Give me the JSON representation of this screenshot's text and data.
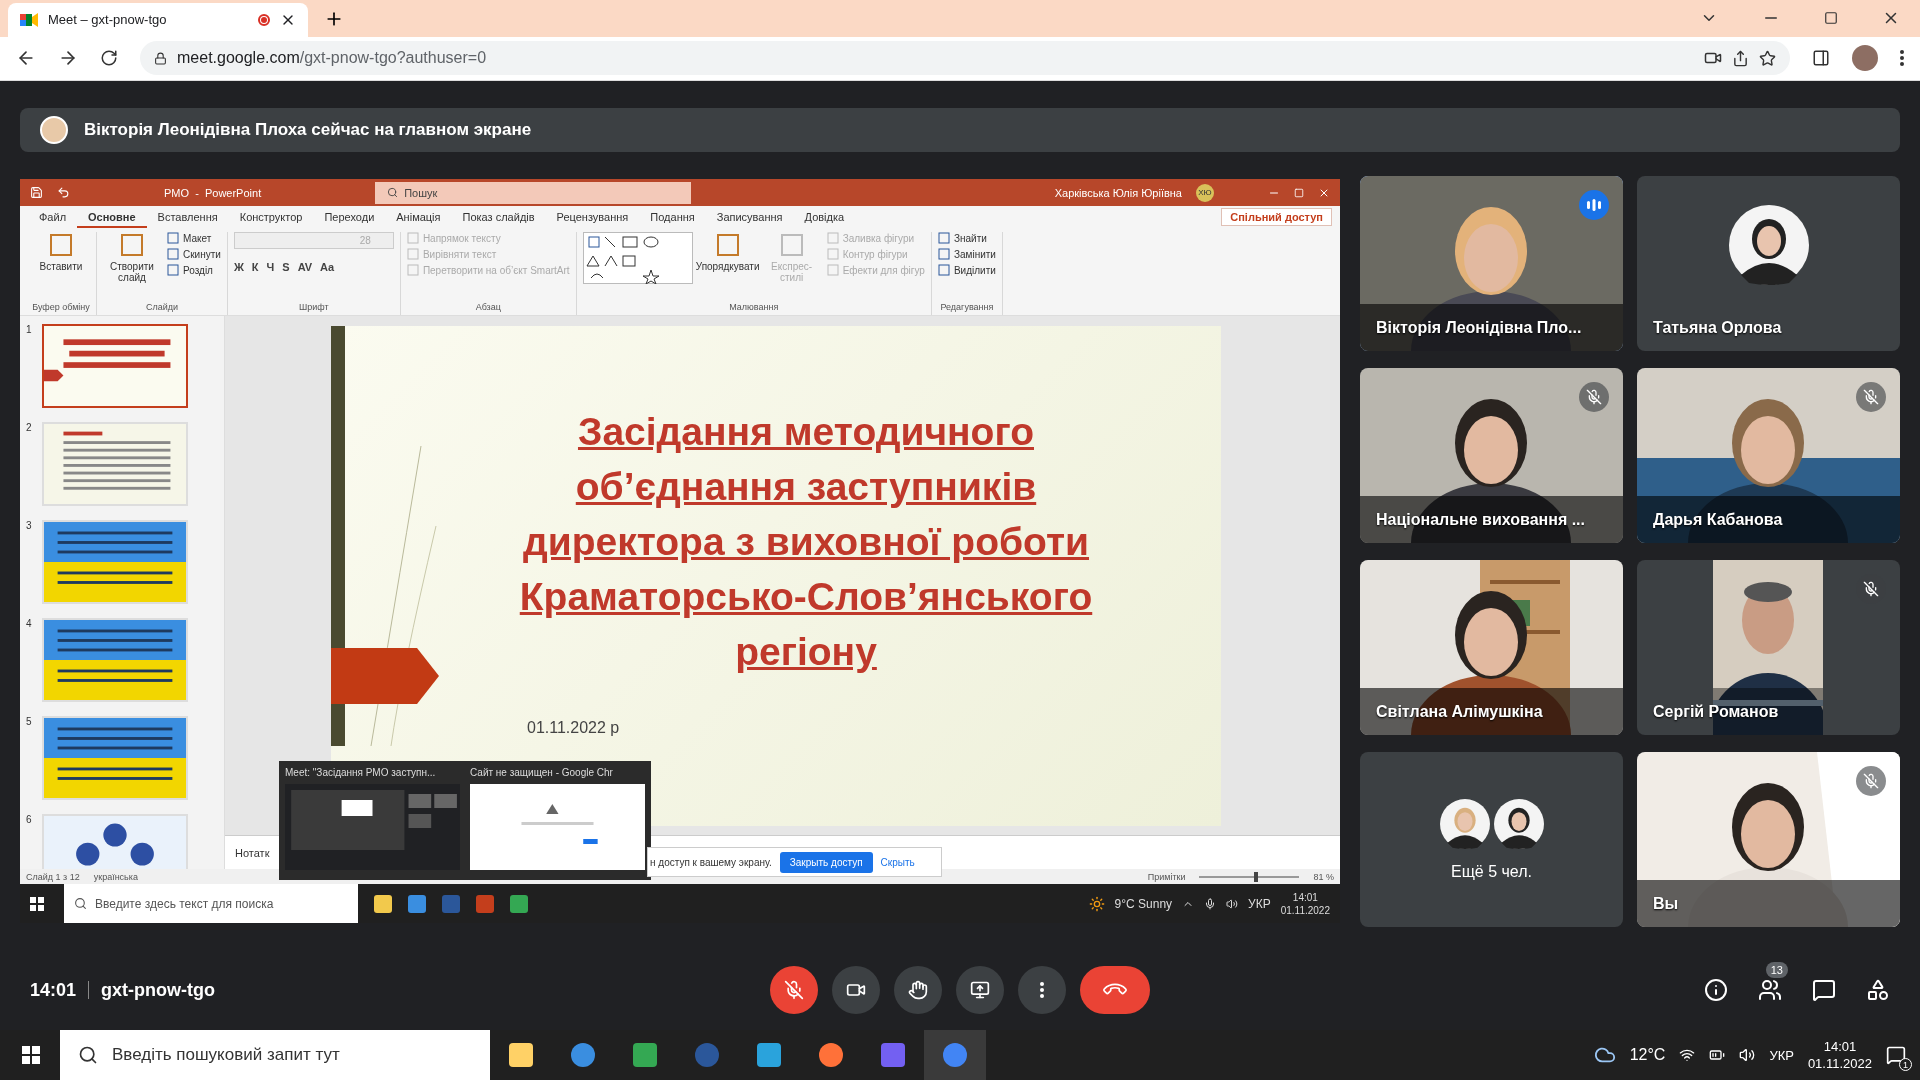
{
  "browser": {
    "tab_title": "Meet – gxt-pnow-tgo",
    "recording": true,
    "url_host": "meet.google.com",
    "url_path": "/gxt-pnow-tgo?authuser=0"
  },
  "banner": {
    "text": "Вікторія Леонідівна Плоха сейчас на главном экране"
  },
  "presentation": {
    "app_title": "PMO  -  PowerPoint",
    "search_placeholder": "Пошук",
    "user_name": "Харківська Юлія Юріївна",
    "user_initials": "ХЮ",
    "tabs": [
      {
        "label": "Файл",
        "selected": false
      },
      {
        "label": "Основне",
        "selected": true
      },
      {
        "label": "Вставлення",
        "selected": false
      },
      {
        "label": "Конструктор",
        "selected": false
      },
      {
        "label": "Переходи",
        "selected": false
      },
      {
        "label": "Анімація",
        "selected": false
      },
      {
        "label": "Показ слайдів",
        "selected": false
      },
      {
        "label": "Рецензування",
        "selected": false
      },
      {
        "label": "Подання",
        "selected": false
      },
      {
        "label": "Записування",
        "selected": false
      },
      {
        "label": "Довідка",
        "selected": false
      }
    ],
    "share_button": "Спільний доступ",
    "ribbon": [
      {
        "label": "Буфер обміну",
        "kind": "buttons",
        "items": [
          {
            "kind": "big",
            "label": "Вставити",
            "disabled": false
          }
        ]
      },
      {
        "label": "Слайди",
        "kind": "buttons",
        "items": [
          {
            "kind": "big",
            "label": "Створити слайд",
            "disabled": false
          },
          {
            "kind": "small",
            "label": "Макет",
            "disabled": false
          },
          {
            "kind": "small",
            "label": "Скинути",
            "disabled": false
          },
          {
            "kind": "small",
            "label": "Розділ",
            "disabled": false
          }
        ]
      },
      {
        "label": "Шрифт",
        "kind": "font",
        "items": [
          {
            "kind": "field",
            "label": "28",
            "disabled": true
          },
          {
            "kind": "glyph",
            "label": "Ж",
            "disabled": false
          },
          {
            "kind": "glyph",
            "label": "К",
            "disabled": false
          },
          {
            "kind": "glyph",
            "label": "Ч",
            "disabled": false
          },
          {
            "kind": "glyph",
            "label": "S",
            "disabled": false
          },
          {
            "kind": "glyph",
            "label": "AV",
            "disabled": false
          },
          {
            "kind": "glyph",
            "label": "Aa",
            "disabled": false
          }
        ]
      },
      {
        "label": "Абзац",
        "kind": "buttons",
        "items": [
          {
            "kind": "small",
            "label": "Напрямок тексту",
            "disabled": true
          },
          {
            "kind": "small",
            "label": "Вирівняти текст",
            "disabled": true
          },
          {
            "kind": "small",
            "label": "Перетворити на об’єкт SmartArt",
            "disabled": true
          }
        ]
      },
      {
        "label": "Малювання",
        "kind": "buttons",
        "items": [
          {
            "kind": "shapes",
            "disabled": false
          },
          {
            "kind": "big",
            "label": "Упорядкувати",
            "disabled": false
          },
          {
            "kind": "big",
            "label": "Експрес-стилі",
            "disabled": true
          },
          {
            "kind": "small",
            "label": "Заливка фігури",
            "disabled": true
          },
          {
            "kind": "small",
            "label": "Контур фігури",
            "disabled": true
          },
          {
            "kind": "small",
            "label": "Ефекти для фігур",
            "disabled": true
          }
        ]
      },
      {
        "label": "Редагування",
        "kind": "buttons",
        "items": [
          {
            "kind": "small",
            "label": "Знайти",
            "disabled": false
          },
          {
            "kind": "small",
            "label": "Замінити",
            "disabled": false
          },
          {
            "kind": "small",
            "label": "Виділити",
            "disabled": false
          }
        ]
      }
    ],
    "slides": [
      {
        "number": "1",
        "kind": "title",
        "selected": true
      },
      {
        "number": "2",
        "kind": "text",
        "selected": false
      },
      {
        "number": "3",
        "kind": "flag",
        "selected": false
      },
      {
        "number": "4",
        "kind": "flag",
        "selected": false
      },
      {
        "number": "5",
        "kind": "flag",
        "selected": false
      },
      {
        "number": "6",
        "kind": "diagram",
        "selected": false
      }
    ],
    "slide": {
      "title_lines": [
        "Засідання методичного",
        "об’єднання заступників",
        "директора з виховної роботи",
        "Краматорсько-Слов’янського",
        "регіону"
      ],
      "date": "01.11.2022 р"
    },
    "notes": "Нотатк",
    "status": {
      "slide_count": "Слайд 1 з 12",
      "language": "українська",
      "notes_button": "Примітки",
      "zoom": "81 %",
      "zoom_slider": {
        "level": 0.55
      }
    },
    "window_previews": [
      {
        "title": "Meet: \"Засідання РМО заступн..."
      },
      {
        "title": "Сайт не защищен - Google Chr"
      }
    ],
    "share_notice": {
      "text": "н доступ к вашему экрану.",
      "stop_button": "Закрыть доступ",
      "hide_link": "Скрыть"
    },
    "taskbar": {
      "search_placeholder": "Введите здесь текст для поиска",
      "weather": "9°C Sunny",
      "language": "УКР",
      "time": "14:01",
      "date": "01.11.2022"
    }
  },
  "participants": [
    {
      "name": "Вікторія Леонідівна Пло...",
      "kind": "video",
      "speaking": true,
      "muted": false
    },
    {
      "name": "Татьяна Орлова",
      "kind": "avatar",
      "speaking": false,
      "muted": false
    },
    {
      "name": "Національне виховання ...",
      "kind": "video",
      "speaking": false,
      "muted": true
    },
    {
      "name": "Дарья Кабанова",
      "kind": "video",
      "speaking": false,
      "muted": true
    },
    {
      "name": "Світлана Алімушкіна",
      "kind": "video",
      "speaking": false,
      "muted": false
    },
    {
      "name": "Сергій Романов",
      "kind": "narrow-video",
      "speaking": false,
      "muted": true
    },
    {
      "name": "Ещё 5 чел.",
      "kind": "more",
      "speaking": false,
      "muted": false
    },
    {
      "name": "Вы",
      "kind": "video",
      "speaking": false,
      "muted": true
    }
  ],
  "meeting_bar": {
    "time": "14:01",
    "code": "gxt-pnow-tgo",
    "mic_on": false,
    "people_count": "13"
  },
  "windows_taskbar": {
    "search_placeholder": "Введіть пошуковий запит тут",
    "weather": "12°C",
    "language": "УКР",
    "time": "14:01",
    "date": "01.11.2022",
    "notifications": "1"
  }
}
